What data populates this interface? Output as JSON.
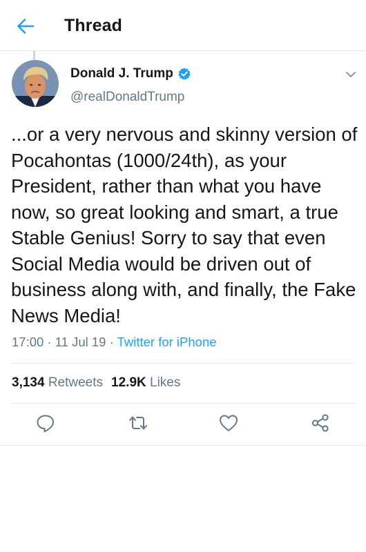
{
  "header": {
    "title": "Thread",
    "back_icon": "arrow-left-icon",
    "accent_color": "#1da1f2"
  },
  "tweet": {
    "author": {
      "display_name": "Donald J. Trump",
      "handle": "@realDonaldTrump",
      "verified": true
    },
    "text": "...or a very nervous and skinny version of Pocahontas (1000/24th), as your President, rather than what you have now, so great looking and smart, a true Stable Genius! Sorry to say that even Social Media would be driven out of business along with, and finally, the Fake News Media!",
    "time": "17:00",
    "date": "11 Jul 19",
    "separator": " · ",
    "source": "Twitter for iPhone",
    "stats": {
      "retweets_count": "3,134",
      "retweets_label": "Retweets",
      "likes_count": "12.9K",
      "likes_label": "Likes"
    }
  },
  "actions": [
    "reply-icon",
    "retweet-icon",
    "like-icon",
    "share-icon"
  ],
  "colors": {
    "text": "#14171a",
    "secondary": "#657786",
    "link": "#1da1f2",
    "border": "#e1e8ed"
  }
}
